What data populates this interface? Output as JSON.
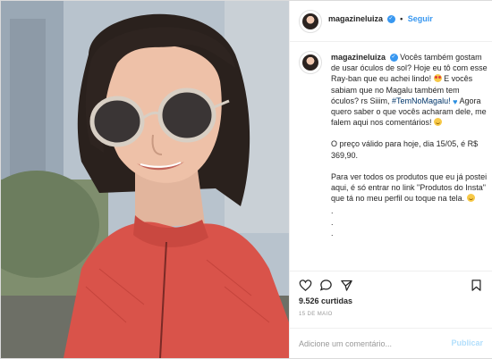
{
  "post": {
    "image_alt": "3D avatar of a woman wearing round Ray-Ban sunglasses and a red jacket",
    "header": {
      "username": "magazineluiza",
      "verified": true,
      "separator": "•",
      "follow_label": "Seguir"
    },
    "caption": {
      "username": "magazineluiza",
      "line1": "Vocês também gostam de usar óculos de sol? Hoje eu tô com esse Ray-ban que eu achei lindo!",
      "line2a": "E vocês sabiam que no Magalu também tem óculos? rs Siiim,",
      "hashtag": "#TemNoMagalu!",
      "line2b": "Agora quero saber o que vocês acharam dele, me falem aqui nos comentários!",
      "price_text": "O preço válido para hoje, dia 15/05, é R$ 369,90.",
      "line4": "Para ver todos os produtos que eu já postei aqui, é só entrar no link \"Produtos do Insta\" que tá no meu perfil ou toque na tela.",
      "dots": [
        ".",
        ".",
        "."
      ]
    },
    "likes": "9.526 curtidas",
    "date": "15 DE MAIO",
    "comment": {
      "placeholder": "Adicione um comentário...",
      "value": "",
      "publish_label": "Publicar"
    },
    "icons": {
      "like": "heart-icon",
      "comment": "comment-icon",
      "share": "share-icon",
      "save": "bookmark-icon"
    },
    "colors": {
      "link_blue": "#3897f0",
      "hashtag": "#003569",
      "publish_disabled": "#b2dffc",
      "jacket": "#d9534a"
    }
  }
}
